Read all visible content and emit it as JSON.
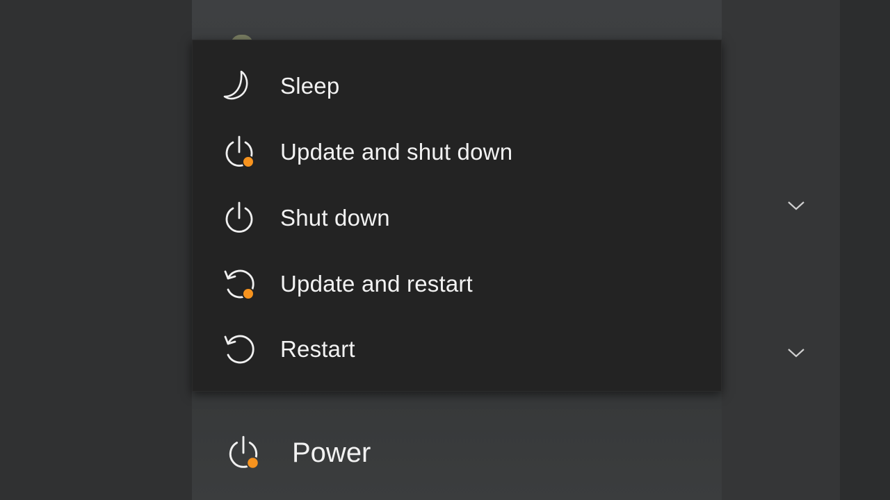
{
  "power_menu": {
    "items": [
      {
        "label": "Sleep",
        "icon": "moon-icon"
      },
      {
        "label": "Update and shut down",
        "icon": "power-update-icon",
        "update_pending": true
      },
      {
        "label": "Shut down",
        "icon": "power-icon"
      },
      {
        "label": "Update and restart",
        "icon": "restart-update-icon",
        "update_pending": true
      },
      {
        "label": "Restart",
        "icon": "restart-icon"
      }
    ]
  },
  "power_button": {
    "label": "Power",
    "icon": "power-update-icon",
    "update_pending": true
  },
  "colors": {
    "flyout_background": "#232323",
    "text": "#f2f2f2",
    "update_badge": "#f7931e",
    "background": "#303132"
  }
}
